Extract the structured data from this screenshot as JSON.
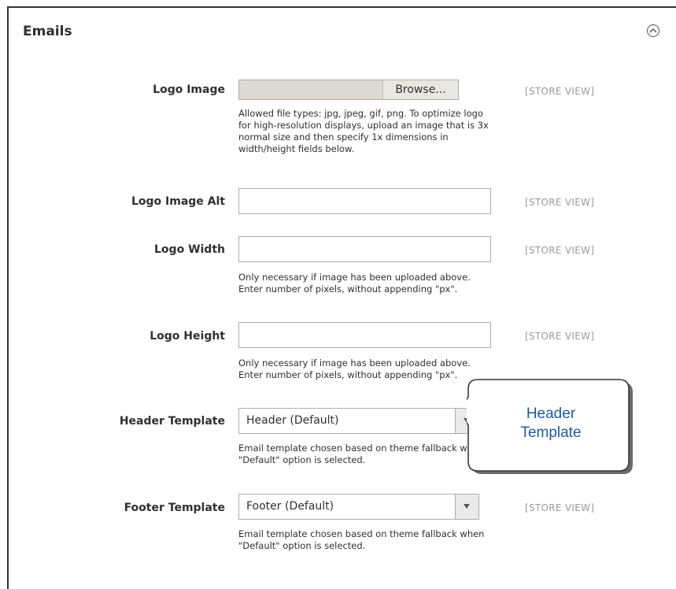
{
  "section": {
    "title": "Emails"
  },
  "scope_label": "[STORE VIEW]",
  "logo_image": {
    "label": "Logo Image",
    "button": "Browse...",
    "note": "Allowed file types: jpg, jpeg, gif, png. To optimize logo for high-resolution displays, upload an image that is 3x normal size and then specify 1x dimensions in width/height fields below."
  },
  "logo_image_alt": {
    "label": "Logo Image Alt",
    "value": ""
  },
  "logo_width": {
    "label": "Logo Width",
    "value": "",
    "note": "Only necessary if image has been uploaded above. Enter number of pixels, without appending \"px\"."
  },
  "logo_height": {
    "label": "Logo Height",
    "value": "",
    "note": "Only necessary if image has been uploaded above. Enter number of pixels, without appending \"px\"."
  },
  "header_template": {
    "label": "Header Template",
    "selected": "Header (Default)",
    "note": "Email template chosen based on theme fallback when \"Default\" option is selected."
  },
  "footer_template": {
    "label": "Footer Template",
    "selected": "Footer (Default)",
    "note": "Email template chosen based on theme fallback when \"Default\" option is selected."
  },
  "callout": {
    "text": "Header Template"
  },
  "icons": {
    "collapse": "chevron-up-circle-icon",
    "select_arrow": "triangle-down-icon"
  },
  "colors": {
    "callout_text": "#1f5a9e",
    "scope_text": "#9a9a9a",
    "border": "#adadad"
  }
}
